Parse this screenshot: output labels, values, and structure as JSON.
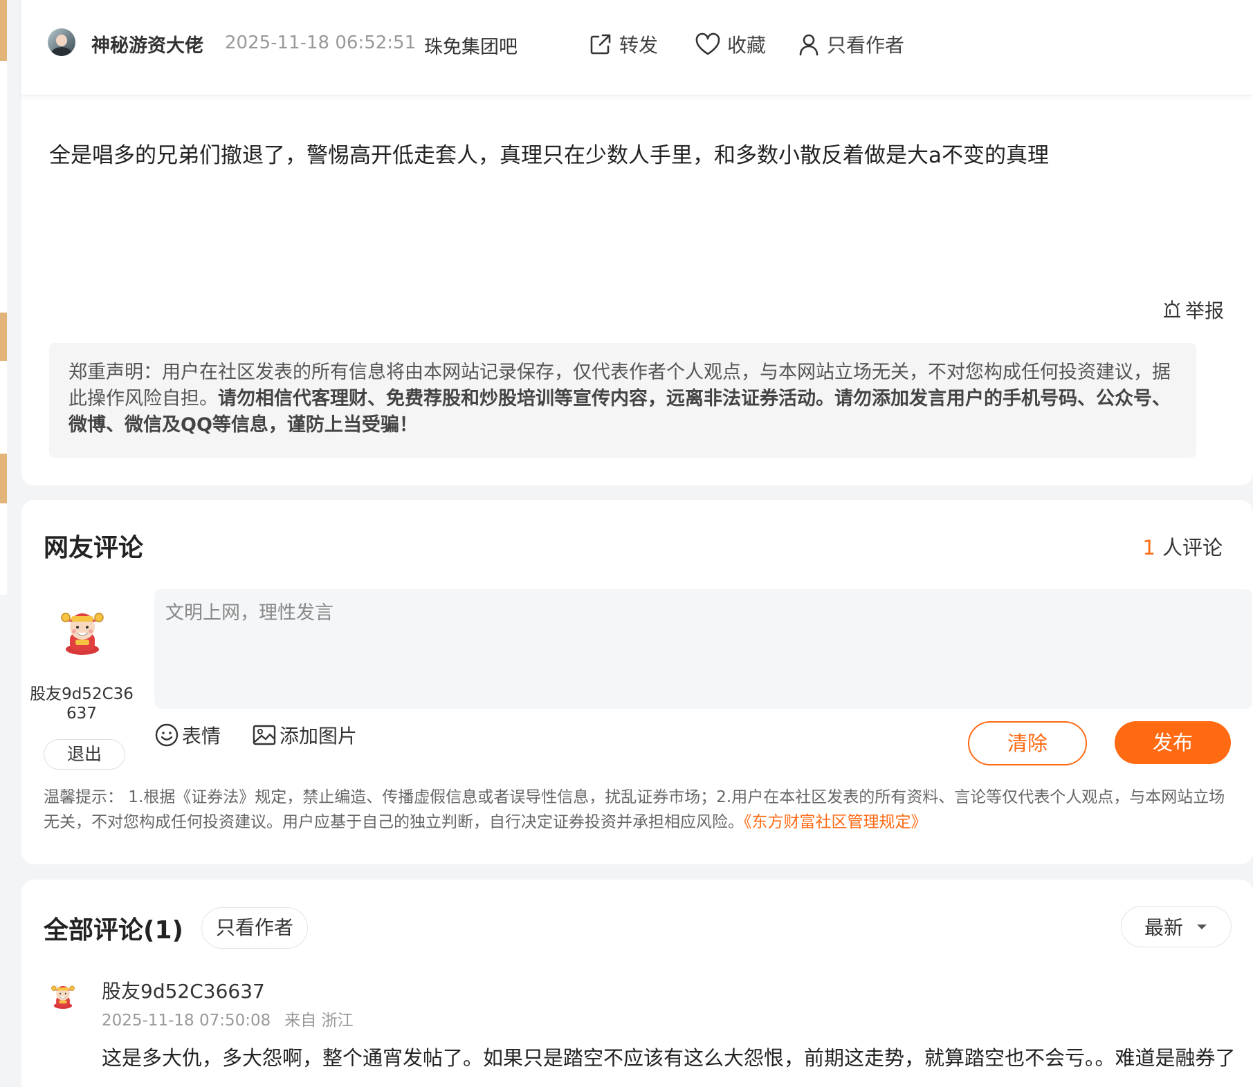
{
  "post": {
    "author": "神秘游资大佬",
    "time": "2025-11-18 06:52:51",
    "bar_name": "珠免集团吧",
    "actions": {
      "share": "转发",
      "favorite": "收藏",
      "author_only": "只看作者"
    },
    "content": "全是唱多的兄弟们撤退了，警惕高开低走套人，真理只在少数人手里，和多数小散反着做是大a不变的真理",
    "report": "举报",
    "disclaimer": {
      "normal": "郑重声明：用户在社区发表的所有信息将由本网站记录保存，仅代表作者个人观点，与本网站立场无关，不对您构成任何投资建议，据此操作风险自担。",
      "bold": "请勿相信代客理财、免费荐股和炒股培训等宣传内容，远离非法证券活动。请勿添加发言用户的手机号码、公众号、微博、微信及QQ等信息，谨防上当受骗！"
    }
  },
  "comment_form": {
    "title": "网友评论",
    "count": "1",
    "count_suffix": "人评论",
    "user_name": "股友9d52C36637",
    "logout": "退出",
    "placeholder": "文明上网，理性发言",
    "emoji_label": "表情",
    "image_label": "添加图片",
    "clear_label": "清除",
    "publish_label": "发布",
    "tips_text": "温馨提示： 1.根据《证券法》规定，禁止编造、传播虚假信息或者误导性信息，扰乱证券市场；2.用户在本社区发表的所有资料、言论等仅代表个人观点，与本网站立场无关，不对您构成任何投资建议。用户应基于自己的独立判断，自行决定证券投资并承担相应风险。",
    "tips_link": "《东方财富社区管理规定》"
  },
  "all_comments": {
    "title": "全部评论(1)",
    "author_filter": "只看作者",
    "sort": "最新",
    "items": [
      {
        "user": "股友9d52C36637",
        "time": "2025-11-18 07:50:08",
        "location": "来自 浙江",
        "text": "这是多大仇，多大怨啊，整个通宵发帖了。如果只是踏空不应该有这么大怨恨，前期这走势，就算踏空也不会亏。。难道是融券了"
      }
    ]
  },
  "colors": {
    "accent": "#ff6a13",
    "page_bg": "#f3f4f6",
    "card_bg": "#ffffff",
    "strip": "#e2b47a"
  },
  "icons": [
    "share-icon",
    "heart-icon",
    "person-icon",
    "alarm-bell-icon",
    "smile-icon",
    "image-icon",
    "caret-down-icon",
    "caishen-avatar"
  ]
}
